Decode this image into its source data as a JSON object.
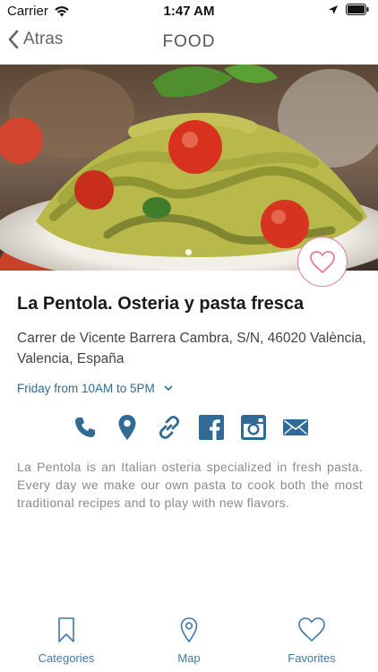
{
  "status_bar": {
    "carrier": "Carrier",
    "time": "1:47 AM"
  },
  "nav": {
    "back_label": "Atras",
    "title": "FOOD"
  },
  "restaurant": {
    "name": "La Pentola. Osteria y pasta fresca",
    "address": "Carrer de Vicente Barrera Cambra, S/N, 46020 València, Valencia, España",
    "hours": "Friday from 10AM to 5PM",
    "description": "La Pentola is an Italian osteria specialized in fresh pasta. Every day we make our own pasta to cook both the most traditional recipes and to play with new flavors."
  },
  "actions": [
    "phone-icon",
    "location-pin-icon",
    "link-icon",
    "facebook-icon",
    "instagram-icon",
    "mail-icon"
  ],
  "tabs": {
    "categories": "Categories",
    "map": "Map",
    "favorites": "Favorites"
  },
  "colors": {
    "accent": "#3e78a8",
    "icon": "#2f6b94",
    "favorite": "#e27a99"
  }
}
